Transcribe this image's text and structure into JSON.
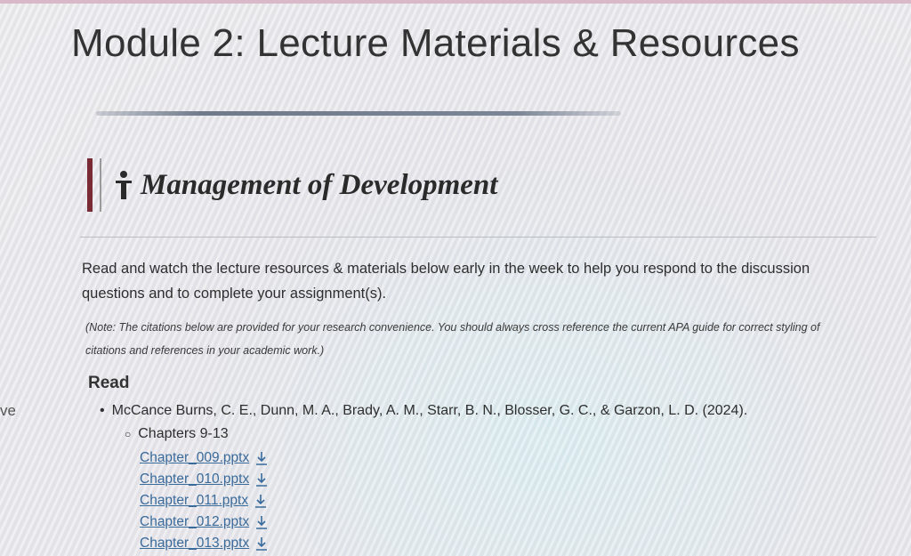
{
  "edge_fragment": "ve",
  "page": {
    "title": "Module 2: Lecture Materials & Resources"
  },
  "section": {
    "title": "Management of Development",
    "icon": "person-icon"
  },
  "intro": {
    "text": "Read and watch the lecture resources & materials below early in the week to help you respond to the discussion questions and to complete your assignment(s).",
    "note": "(Note: The citations below are provided for your research convenience. You should always cross reference the current APA guide for correct styling of citations and references in your academic work.)"
  },
  "read": {
    "heading": "Read",
    "reference": "McCance Burns, C. E., Dunn, M. A., Brady, A. M., Starr, B. N., Blosser, G. C., & Garzon, L. D. (2024).",
    "chapters_label": "Chapters 9-13",
    "files": [
      {
        "name": "Chapter_009.pptx",
        "icon": "download-icon"
      },
      {
        "name": "Chapter_010.pptx",
        "icon": "download-icon"
      },
      {
        "name": "Chapter_011.pptx",
        "icon": "download-icon"
      },
      {
        "name": "Chapter_012.pptx",
        "icon": "download-icon"
      },
      {
        "name": "Chapter_013.pptx",
        "icon": "download-icon"
      }
    ]
  },
  "colors": {
    "accent_bar": "#7a2a34",
    "link": "#3a6a9a",
    "text": "#2e2e2e"
  }
}
